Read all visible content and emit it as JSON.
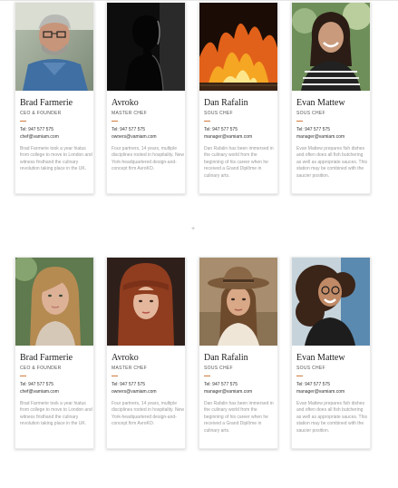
{
  "divider_mark": "+",
  "rows": [
    {
      "cards": [
        {
          "name": "Brad Farmerie",
          "role": "CEO & FOUNDER",
          "tel": "Tel: 947 577 575",
          "email": "chef@vamiam.com",
          "desc": "Brad Farmerie took a year hiatus from college to move to London and witness firsthand the culinary revolution taking place in the UK.",
          "photo": "man-gray-hair-glasses"
        },
        {
          "name": "Avroko",
          "role": "MASTER CHEF",
          "tel": "Tel: 947 577 575",
          "email": "owners@vamiam.com",
          "desc": "Four partners, 14 years, multiple disciplines rooted in hospitality. New York-headquartered design-and-concept firm AvroKO.",
          "photo": "man-silhouette-dark"
        },
        {
          "name": "Dan Rafalin",
          "role": "SOUS CHEF",
          "tel": "Tel: 947 577 575",
          "email": "manager@vamiam.com",
          "desc": "Dan Rafalin has been immersed in the culinary world from the beginning of his career when he received a Grand Diplôme in culinary arts.",
          "photo": "grill-fire"
        },
        {
          "name": "Evan Mattew",
          "role": "SOUS CHEF",
          "tel": "Tel: 947 577 575",
          "email": "manager@vamiam.com",
          "desc": "Evan Mattew prepares fish dishes and often does all fish butchering as well as appropriate sauces. This station may be combined with the saucier position.",
          "photo": "woman-smiling-striped"
        }
      ]
    },
    {
      "cards": [
        {
          "name": "Brad Farmerie",
          "role": "CEO & FOUNDER",
          "tel": "Tel: 947 577 575",
          "email": "chef@vamiam.com",
          "desc": "Brad Farmerie took a year hiatus from college to move to London and witness firsthand the culinary revolution taking place in the UK.",
          "photo": "woman-blonde-hair"
        },
        {
          "name": "Avroko",
          "role": "MASTER CHEF",
          "tel": "Tel: 947 577 575",
          "email": "owners@vamiam.com",
          "desc": "Four partners, 14 years, multiple disciplines rooted in hospitality. New York-headquartered design-and-concept firm AvroKO.",
          "photo": "woman-red-hair"
        },
        {
          "name": "Dan Rafalin",
          "role": "SOUS CHEF",
          "tel": "Tel: 947 577 575",
          "email": "manager@vamiam.com",
          "desc": "Dan Rafalin has been immersed in the culinary world from the beginning of his career when he received a Grand Diplôme in culinary arts.",
          "photo": "woman-hat"
        },
        {
          "name": "Evan Mattew",
          "role": "SOUS CHEF",
          "tel": "Tel: 947 577 575",
          "email": "manager@vamiam.com",
          "desc": "Evan Mattew prepares fish dishes and often does all fish butchering as well as appropriate sauces. This station may be combined with the saucier position.",
          "photo": "woman-curly-hair-glasses"
        }
      ]
    }
  ]
}
